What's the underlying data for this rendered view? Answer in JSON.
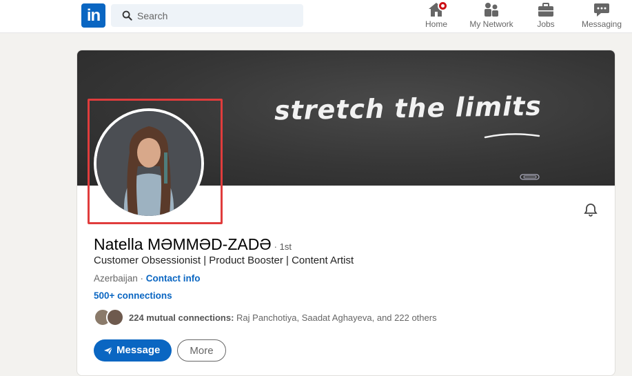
{
  "nav": {
    "logo": "in",
    "search_placeholder": "Search",
    "items": [
      {
        "label": "Home",
        "icon": "home-icon"
      },
      {
        "label": "My Network",
        "icon": "my-network-icon"
      },
      {
        "label": "Jobs",
        "icon": "briefcase-icon"
      },
      {
        "label": "Messaging",
        "icon": "chat-icon"
      }
    ]
  },
  "banner": {
    "text": "stretch the limits"
  },
  "profile": {
    "name": "Natella MƏMMƏD-ZADƏ",
    "degree": "· 1st",
    "headline": "Customer Obsessionist | Product Booster | Content Artist",
    "location": "Azerbaijan",
    "location_sep": " · ",
    "contact_info": "Contact info",
    "connections": "500+ connections",
    "mutual_bold": "224 mutual connections:",
    "mutual_rest": " Raj Panchotiya, Saadat Aghayeva, and 222 others"
  },
  "actions": {
    "message": "Message",
    "more": "More"
  },
  "colors": {
    "brand": "#0a66c2",
    "highlight": "#e03c3c",
    "badge": "#cc1016"
  }
}
